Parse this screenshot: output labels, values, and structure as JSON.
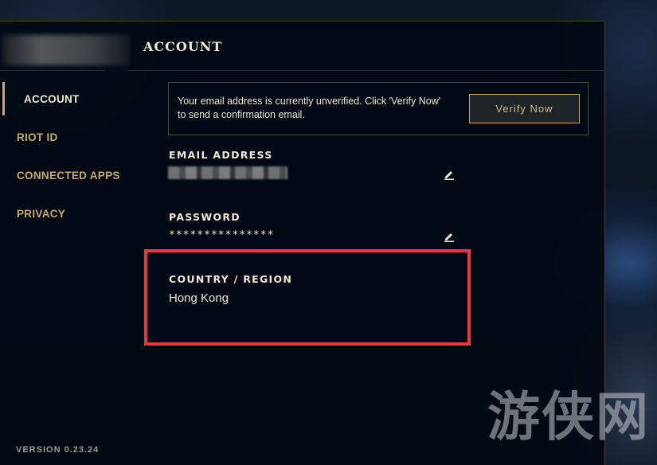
{
  "header": {
    "title": "ACCOUNT"
  },
  "sidebar": {
    "items": [
      {
        "label": "ACCOUNT",
        "active": true
      },
      {
        "label": "RIOT ID",
        "active": false
      },
      {
        "label": "CONNECTED APPS",
        "active": false
      },
      {
        "label": "PRIVACY",
        "active": false
      }
    ],
    "version": "VERSION 0.23.24"
  },
  "notice": {
    "text": "Your email address is currently unverified. Click 'Verify Now' to send a confirmation email.",
    "button_label": "Verify Now"
  },
  "fields": {
    "email_label": "EMAIL ADDRESS",
    "password_label": "PASSWORD",
    "password_value": "***************",
    "country_label": "COUNTRY / REGION",
    "country_value": "Hong Kong"
  },
  "watermark": "游侠网",
  "colors": {
    "gold": "#c8aa6e",
    "text": "#f0e6d2",
    "highlight": "#e8383d"
  }
}
